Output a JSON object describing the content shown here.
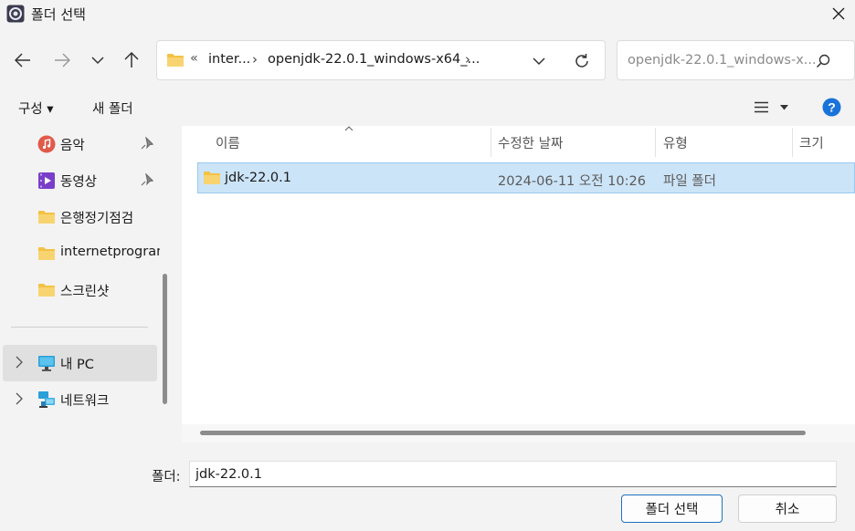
{
  "window": {
    "title": "폴더 선택"
  },
  "nav": {
    "back_icon": "arrow-left-icon",
    "forward_icon": "arrow-right-icon",
    "recent_icon": "chevron-down-icon",
    "up_icon": "arrow-up-icon"
  },
  "address": {
    "overflow": "«",
    "crumbs": [
      "inter...",
      "openjdk-22.0.1_windows-x64_..."
    ],
    "separator": "›"
  },
  "search": {
    "placeholder": "openjdk-22.0.1_windows-x..."
  },
  "commands": {
    "organize": "구성 ▾",
    "new_folder": "새 폴더"
  },
  "sidebar": {
    "items": [
      {
        "label": "음악",
        "icon": "music-icon",
        "pinned": true
      },
      {
        "label": "동영상",
        "icon": "video-icon",
        "pinned": true
      },
      {
        "label": "은행정기점검",
        "icon": "folder-icon"
      },
      {
        "label": "internetprogram",
        "icon": "folder-icon"
      },
      {
        "label": "스크린샷",
        "icon": "folder-icon"
      },
      {
        "label": "내 PC",
        "icon": "computer-icon",
        "selected": true
      },
      {
        "label": "네트워크",
        "icon": "network-icon"
      }
    ]
  },
  "filelist": {
    "columns": [
      "이름",
      "수정한 날짜",
      "유형",
      "크기"
    ],
    "rows": [
      {
        "name": "jdk-22.0.1",
        "modified": "2024-06-11 오전 10:26",
        "type": "파일 폴더",
        "size": ""
      }
    ]
  },
  "footer": {
    "folder_label": "폴더:",
    "folder_value": "jdk-22.0.1",
    "select_button": "폴더 선택",
    "cancel_button": "취소"
  },
  "colors": {
    "accent": "#1f6fbf",
    "selection": "#cce4f7",
    "folder": "#f3c244",
    "help": "#1a73d9"
  }
}
